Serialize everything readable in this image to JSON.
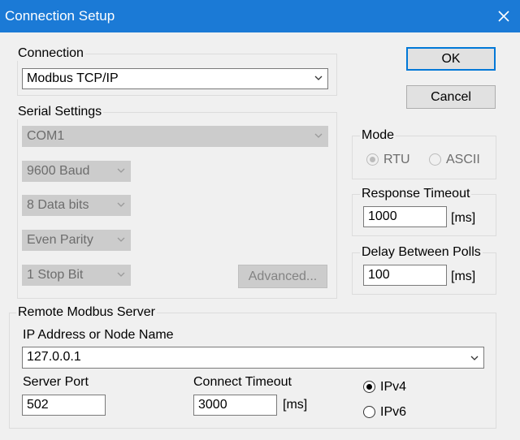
{
  "window": {
    "title": "Connection Setup",
    "close_icon": "close-icon"
  },
  "buttons": {
    "ok": "OK",
    "cancel": "Cancel",
    "advanced": "Advanced..."
  },
  "connection": {
    "legend": "Connection",
    "value": "Modbus TCP/IP"
  },
  "serial": {
    "legend": "Serial Settings",
    "port": "COM1",
    "baud": "9600 Baud",
    "data_bits": "8 Data bits",
    "parity": "Even Parity",
    "stop_bits": "1 Stop Bit"
  },
  "mode": {
    "legend": "Mode",
    "rtu": "RTU",
    "ascii": "ASCII",
    "selected": "RTU"
  },
  "response_timeout": {
    "legend": "Response Timeout",
    "value": "1000",
    "unit": "[ms]"
  },
  "delay_polls": {
    "legend": "Delay Between Polls",
    "value": "100",
    "unit": "[ms]"
  },
  "remote": {
    "legend": "Remote Modbus Server",
    "ip_label": "IP Address or Node Name",
    "ip_value": "127.0.0.1",
    "port_label": "Server Port",
    "port_value": "502",
    "timeout_label": "Connect Timeout",
    "timeout_value": "3000",
    "timeout_unit": "[ms]",
    "ipv4": "IPv4",
    "ipv6": "IPv6",
    "selected_ip": "IPv4"
  }
}
